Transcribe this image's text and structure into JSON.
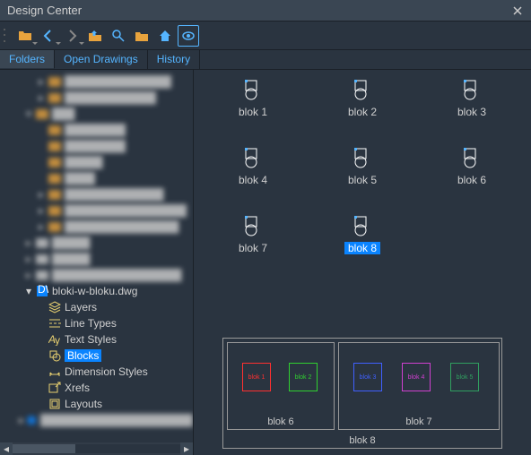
{
  "window": {
    "title": "Design Center"
  },
  "tabs": {
    "t0": "Folders",
    "t1": "Open Drawings",
    "t2": "History"
  },
  "tree": {
    "file": "bloki-w-bloku.dwg",
    "n0": "Layers",
    "n1": "Line Types",
    "n2": "Text Styles",
    "n3": "Blocks",
    "n4": "Dimension Styles",
    "n5": "Xrefs",
    "n6": "Layouts"
  },
  "blocks": {
    "b1": "blok 1",
    "b2": "blok 2",
    "b3": "blok 3",
    "b4": "blok 4",
    "b5": "blok 5",
    "b6": "blok 6",
    "b7": "blok 7",
    "b8": "blok 8"
  },
  "preview": {
    "outer": "blok  8",
    "g6": "blok  6",
    "g7": "blok  7",
    "s1": "blok 1",
    "s2": "blok 2",
    "s3": "blok 3",
    "s4": "blok 4",
    "s5": "blok 5"
  },
  "colors": {
    "s1": "#ff3030",
    "s2": "#30d030",
    "s3": "#4060ff",
    "s4": "#d040d0",
    "s5": "#30a060"
  }
}
